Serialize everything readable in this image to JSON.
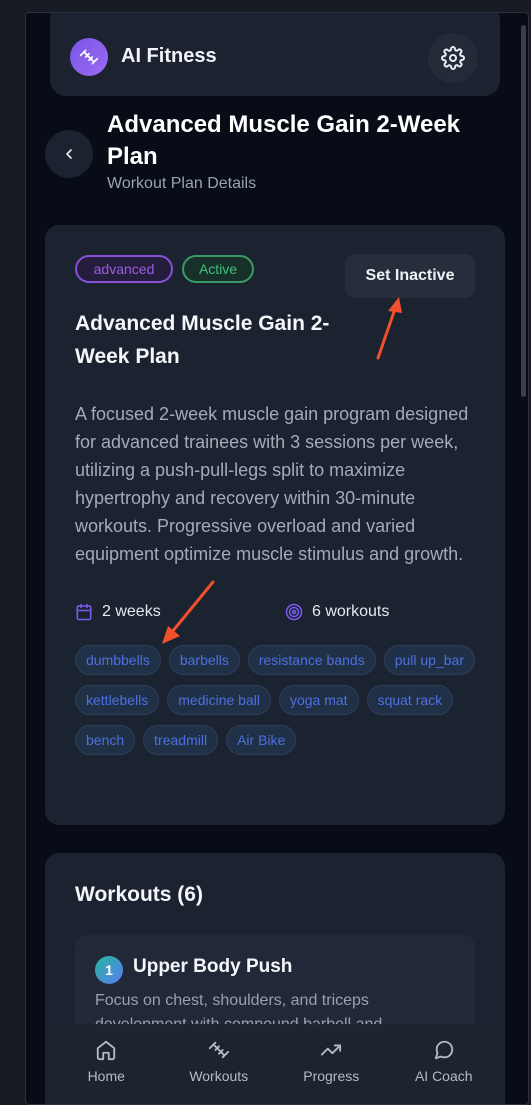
{
  "app": {
    "name": "AI Fitness",
    "logo_icon": "dumbbell-icon",
    "settings_icon": "gear-icon"
  },
  "header": {
    "title": "Advanced Muscle Gain 2-Week Plan",
    "subtitle": "Workout Plan Details",
    "back_icon": "chevron-left-icon"
  },
  "plan": {
    "level_badge": "advanced",
    "status_badge": "Active",
    "set_inactive_label": "Set Inactive",
    "title": "Advanced Muscle Gain 2-Week Plan",
    "description": "A focused 2-week muscle gain program designed for advanced trainees with 3 sessions per week, utilizing a push-pull-legs split to maximize hypertrophy and recovery within 30-minute workouts. Progressive overload and varied equipment optimize muscle stimulus and growth.",
    "duration": "2 weeks",
    "workout_count": "6 workouts",
    "equipment": [
      "dumbbells",
      "barbells",
      "resistance bands",
      "pull up_bar",
      "kettlebells",
      "medicine ball",
      "yoga mat",
      "squat rack",
      "bench",
      "treadmill",
      "Air Bike"
    ]
  },
  "workouts": {
    "heading": "Workouts (6)",
    "items": [
      {
        "number": "1",
        "title": "Upper Body Push",
        "description": "Focus on chest, shoulders, and triceps development with compound barbell and"
      }
    ]
  },
  "nav": {
    "items": [
      {
        "label": "Home",
        "icon": "home-icon"
      },
      {
        "label": "Workouts",
        "icon": "dumbbell-icon"
      },
      {
        "label": "Progress",
        "icon": "trending-up-icon"
      },
      {
        "label": "AI Coach",
        "icon": "chat-icon"
      }
    ]
  },
  "colors": {
    "background": "#070c17",
    "card": "#1b2230",
    "accent_purple": "#8a50d8",
    "accent_green": "#3fc07a",
    "tag_text": "#4d6fe0",
    "annotation_arrow": "#f0502b"
  }
}
